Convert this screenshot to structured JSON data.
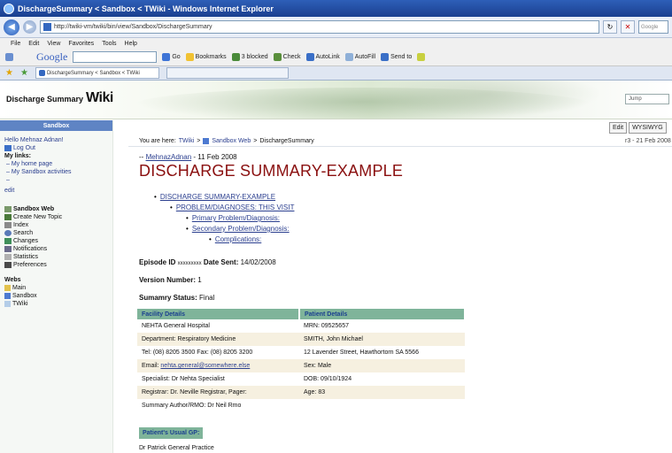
{
  "window": {
    "title": "DischargeSummary < Sandbox < TWiki - Windows Internet Explorer",
    "address": "http://twiki-vm/twiki/bin/view/Sandbox/DischargeSummary",
    "search_placeholder": "Google"
  },
  "menu": [
    "File",
    "Edit",
    "View",
    "Favorites",
    "Tools",
    "Help"
  ],
  "google_toolbar": {
    "logo": "Google",
    "items": [
      "Go",
      "Bookmarks",
      "3 blocked",
      "Check",
      "AutoLink",
      "AutoFill",
      "Send to"
    ]
  },
  "tab": {
    "label": "DischargeSummary < Sandbox < TWiki"
  },
  "banner": {
    "site_title": "Discharge Summary",
    "wiki_word": "Wiki",
    "jump_placeholder": "Jump"
  },
  "sidebar": {
    "header": "Sandbox",
    "hello": "Hello Mehnaz Adnan!",
    "logout": "Log Out",
    "my_links_title": "My links:",
    "my_links": [
      "My home page",
      "My Sandbox activities"
    ],
    "edit": "edit",
    "web_items": [
      "Sandbox Web",
      "Create New Topic",
      "Index",
      "Search",
      "Changes",
      "Notifications",
      "Statistics",
      "Preferences"
    ],
    "webs_title": "Webs",
    "webs": [
      {
        "label": "Main",
        "color": "#e3c24c"
      },
      {
        "label": "Sandbox",
        "color": "#4d7ad1"
      },
      {
        "label": "TWiki",
        "color": "#b4cde8"
      }
    ]
  },
  "actions": {
    "edit": "Edit",
    "wysiwyg": "WYSIWYG"
  },
  "breadcrumb": {
    "prefix": "You are here:",
    "twiki": "TWiki",
    "sep": ">",
    "web": "Sandbox Web",
    "sep2": ">",
    "topic": "DischargeSummary"
  },
  "revision": "r3 - 21 Feb 2008",
  "content": {
    "author": "MehnazAdnan",
    "date": "- 11 Feb 2008",
    "author_prefix": "--",
    "title": "DISCHARGE SUMMARY-EXAMPLE",
    "toc": [
      "DISCHARGE SUMMARY-EXAMPLE",
      "PROBLEM/DIAGNOSES: THIS VISIT",
      "Primary Problem/Diagnosis:",
      "Secondary Problem/Diagnosis:",
      "Complications:"
    ],
    "episode": {
      "label": "Episode ID",
      "value": "xxxxxxxxx",
      "sent_label": "Date Sent:",
      "sent_value": "14/02/2008"
    },
    "version": {
      "label": "Version Number:",
      "value": "1"
    },
    "status": {
      "label": "Sumamry Status:",
      "value": "Final"
    },
    "table": {
      "headers": [
        "Facility Details",
        "Patient Details"
      ],
      "rows": [
        [
          "NEHTA General Hospital",
          "MRN: 09525657"
        ],
        [
          "Department: Respiratory Medicine",
          "SMITH, John Michael"
        ],
        [
          "Tel: (08) 8205 3500 Fax: (08) 8205 3200",
          "12 Lavender Street, Hawthortorn SA 5566"
        ],
        [
          "nehta.general@somewhere.else",
          "Sex: Male"
        ],
        [
          "Specialist: Dr Nehta Specialist",
          "DOB: 09/10/1924"
        ],
        [
          "Registrar: Dr. Neville Registrar, Pager:",
          "Age: 83"
        ],
        [
          "Summary Author/RMO: Dr Neil Rmo",
          ""
        ]
      ],
      "email_label": "Email:"
    },
    "gp_header": "Patient's Usual GP:",
    "gp_name": "Dr Patrick General Practice"
  }
}
